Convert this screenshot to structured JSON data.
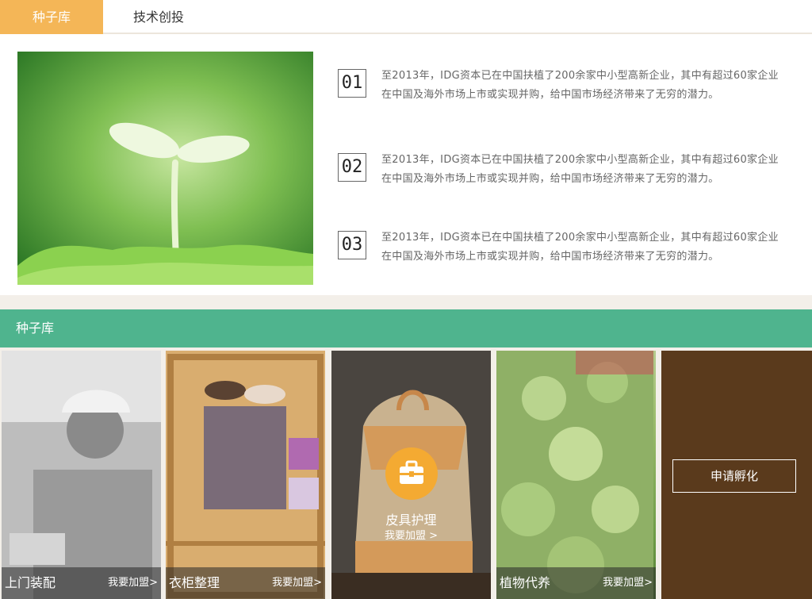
{
  "tabs": [
    {
      "label": "种子库"
    },
    {
      "label": "技术创投"
    }
  ],
  "items": [
    {
      "num": "01",
      "text": "至2013年，IDG资本已在中国扶植了200余家中小型高新企业，其中有超过60家企业在中国及海外市场上市或实现并购，给中国市场经济带来了无穷的潜力。"
    },
    {
      "num": "02",
      "text": "至2013年，IDG资本已在中国扶植了200余家中小型高新企业，其中有超过60家企业在中国及海外市场上市或实现并购，给中国市场经济带来了无穷的潜力。"
    },
    {
      "num": "03",
      "text": "至2013年，IDG资本已在中国扶植了200余家中小型高新企业，其中有超过60家企业在中国及海外市场上市或实现并购，给中国市场经济带来了无穷的潜力。"
    }
  ],
  "section": {
    "title": "种子库"
  },
  "cards": [
    {
      "title": "上门装配",
      "link": "我要加盟>"
    },
    {
      "title": "衣柜整理",
      "link": "我要加盟>"
    },
    {
      "title": "皮具护理",
      "link": "我要加盟 >"
    },
    {
      "title": "植物代养",
      "link": "我要加盟>"
    }
  ],
  "apply": {
    "label": "申请孵化"
  },
  "icons": {
    "briefcase": "briefcase-icon"
  },
  "colors": {
    "tab_active": "#f4b657",
    "section_bar": "#4fb48e",
    "badge": "#f4aa32",
    "apply_bg": "#5a3a1c"
  }
}
